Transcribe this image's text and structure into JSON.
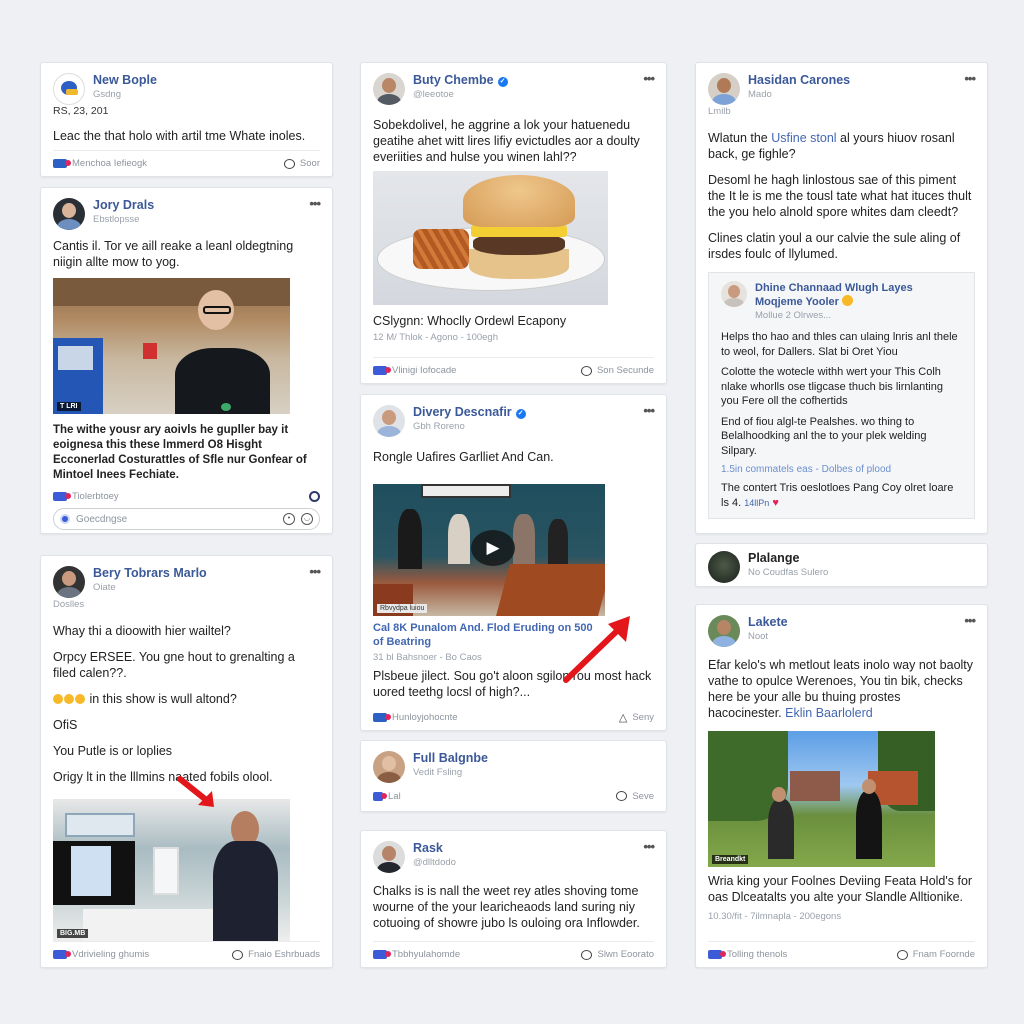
{
  "posts": {
    "new_bople": {
      "name": "New Bople",
      "sub": "Gsdng",
      "date": "RS, 23, 201",
      "text": "Leac the that holo with artil tme Whate inoles.",
      "footer_left": "Menchoa Iefieogk",
      "footer_right": "Soor"
    },
    "jory_drals": {
      "name": "Jory Drals",
      "sub": "Ebstlopsse",
      "text": "Cantis il. Tor ve aill reake a leanl oldegtning niigin allte mow to yog.",
      "image_tag": "T LRI",
      "caption": "The withe yousr ary aoivls he gupller bay it eoignesa this these lmmerd O8 Hisght Ecconerlad Costurattles of Sfle nur Gonfear of Mintoel Inees Fechiate.",
      "footer_left": "Tiolerbtoey",
      "comment_placeholder": "Goecdngse"
    },
    "bery_tobrars": {
      "name": "Bery Tobrars Marlo",
      "sub": "Oiate",
      "sub2": "Doslles",
      "lines": [
        "Whay thi a dioowith hier wailtel?",
        "Orpcy ERSEE. You gne hout to grenalting a filed calen??.",
        "in this show is wull altond?",
        "OfiS",
        "You Putle is or loplies",
        "Origy lt in the lllmins naated fobils olool."
      ],
      "image_tag": "BIG.MB",
      "footer_left": "Vdrivieling ghumis",
      "footer_right": "Fnaio Eshrbuads"
    },
    "buty_chembe": {
      "name": "Buty Chembe",
      "sub": "@leeotoe",
      "text": "Sobekdolivel, he aggrine a lok your hatuenedu geatihe ahet witt lires lifiy evictudles aor a doulty everiities and hulse you winen lahl??",
      "title": "CSlygnn: Whoclly Ordewl Ecapony",
      "meta": "12 M/ Thlok - Agono - 100egh",
      "footer_left": "Vlinigi Iofocade",
      "footer_right": "Son Secunde"
    },
    "divery_descnafir": {
      "name": "Divery Descnafir",
      "sub": "Gbh Roreno",
      "text": "Rongle Uafires Garlliet And Can.",
      "image_tag": "Rbvydpa luiou",
      "title": "Cal 8K Punalom And. Flod Eruding on 500 of Beatring",
      "meta": "31 bl Bahsnoer - Bo Caos",
      "text2": "Plsbeue jilect. Sou go't aloon sgilon rou most hack uored teethg locsl of high?...",
      "footer_left": "Hunloyjohocnte",
      "footer_right": "Seny"
    },
    "full_balgnbe": {
      "name": "Full Balgnbe",
      "sub": "Vedit Fsling",
      "footer_left": "Lal",
      "footer_right": "Seve"
    },
    "rask": {
      "name": "Rask",
      "sub": "@dlltdodo",
      "text": "Chalks is is nall the weet rey atles shoving tome wourne of the your learicheaods land suring niy cotuoing of showre jubo ls ouloing ora Inflowder.",
      "footer_left": "Tbbhyulahomde",
      "footer_right": "Slwn Eoorato"
    },
    "hasidan_carones": {
      "name": "Hasidan Carones",
      "sub": "Mado",
      "sub2": "Lmilb",
      "p1_a": "Wlatun the ",
      "p1_link": "Usfine stonl",
      "p1_b": " al yours hiuov rosanl back, ge fighle?",
      "p2": "Desoml he hagh linlostous sae of this piment the It le is me the tousl tate what hat ituces thult the you helo alnold spore whites dam cleedt?",
      "p3": "Clines clatin youl a our calvie the sule aling of irsdes foulc of llylumed.",
      "nested": {
        "name": "Dhine Channaad Wlugh Layes Moqjeme Yooler",
        "sub": "Mollue 2 Olrwes...",
        "p1": "Helps tho hao and thles can ulaing lnris anl thele to weol, for Dallers. Slat bi Oret Yiou",
        "p2": "Colotte the wotecle withh wert your This Colh nlake whorlls ose tligcase thuch bis lirnlanting you Fere oll the cofhertids",
        "p3": "End of fiou algl-te Pealshes. wo thing to Belalhoodking anl the to your plek welding Silpary.",
        "stats": "1.5in commatels eas - Dolbes of plood",
        "p4_a": "The contert Tris oeslotloes Pang Coy olret loare ls 4.",
        "p4_time": "14llPn"
      }
    },
    "plalange": {
      "name": "Plalange",
      "sub": "No Coudfas Sulero"
    },
    "lakete": {
      "name": "Lakete",
      "sub": "Noot",
      "text_a": "Efar kelo's wh metlout leats inolo way not baolty vathe to opulce Werenoes, You tin bik, checks here be your alle bu thuing prostes hacocinester. ",
      "text_link": "Eklin Baarlolerd",
      "image_tag": "Breandkt",
      "caption": "Wria king your Foolnes Deviing Feata Hold's for oas Dlceatalts you alte your Slandle Alltionike.",
      "meta": "10.30/fit - 7ilmnapla - 200egons",
      "footer_left": "Tolling thenols",
      "footer_right": "Fnam Foornde"
    }
  },
  "more_label": "•••",
  "verified_glyph": "✓",
  "play_glyph": "▶"
}
